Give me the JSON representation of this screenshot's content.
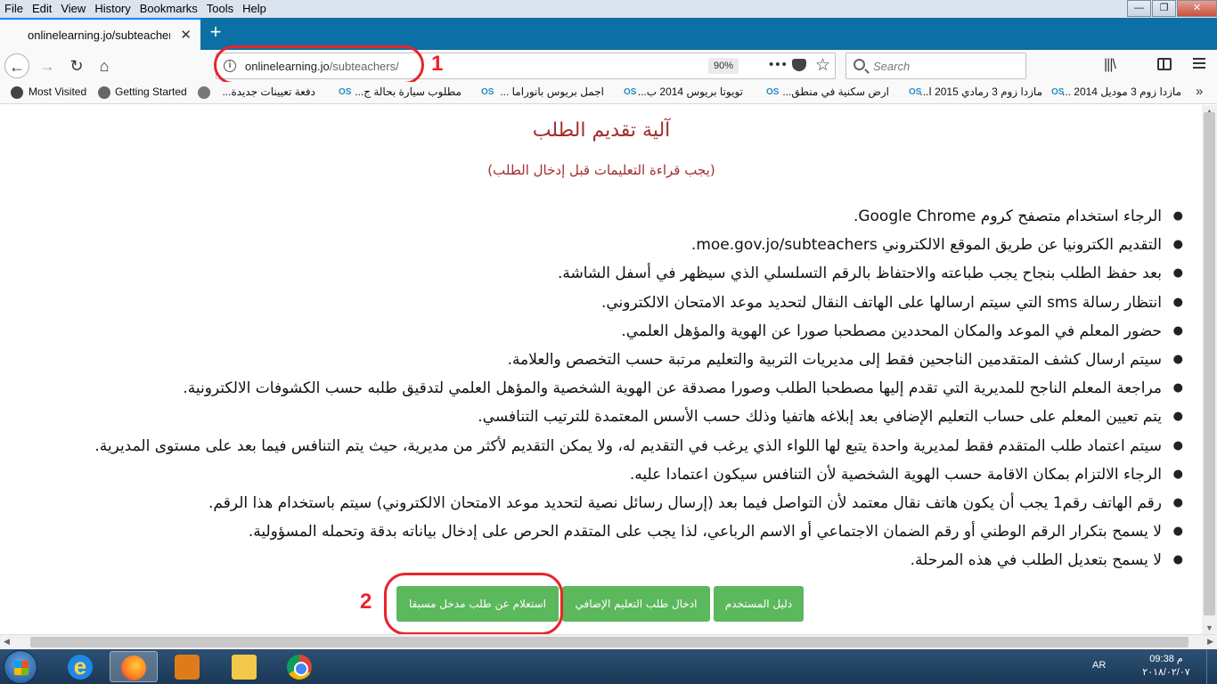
{
  "menubar": {
    "items": [
      "File",
      "Edit",
      "View",
      "History",
      "Bookmarks",
      "Tools",
      "Help"
    ]
  },
  "window_controls": {
    "minimize": "—",
    "maximize": "❐",
    "close": "✕"
  },
  "tab": {
    "title": "onlinelearning.jo/subteachers/",
    "close": "✕",
    "new_tab": "+"
  },
  "navbar": {
    "url_host": "onlinelearning.jo",
    "url_path": "/subteachers/",
    "zoom": "90%",
    "page_actions": "•••",
    "search_placeholder": "Search"
  },
  "annotations": {
    "label_1": "1",
    "label_2": "2",
    "color": "#e8242c"
  },
  "bookmarks": {
    "most_visited": "Most Visited",
    "getting_started": "Getting Started",
    "items": [
      "دفعة تعيينات جديدة...",
      "مطلوب سيارة بحالة ج...",
      "اجمل بريوس بانوراما ...",
      "تويوتا بريوس 2014 ب...",
      "ارض سكنية في منطق...",
      "مازدا زوم 3 رمادي 2015 ا...",
      "مازدا زوم 3 موديل 2014 ..."
    ],
    "badge": "OS"
  },
  "page": {
    "title": "آلية تقديم الطلب",
    "subtitle": "(يجب قراءة التعليمات قبل إدخال الطلب)",
    "title_color": "#a42d2d",
    "rules": [
      "الرجاء استخدام متصفح كروم Google Chrome.",
      "التقديم الكترونيا عن طريق الموقع الالكتروني moe.gov.jo/subteachers.",
      "بعد حفظ الطلب بنجاح يجب طباعته والاحتفاظ بالرقم التسلسلي الذي سيظهر في أسفل الشاشة.",
      "انتظار رسالة sms التي سيتم ارسالها على الهاتف النقال لتحديد موعد الامتحان الالكتروني.",
      "حضور المعلم في الموعد والمكان المحددين مصطحبا صورا عن الهوية والمؤهل العلمي.",
      "سيتم ارسال كشف المتقدمين الناجحين فقط إلى مديريات التربية والتعليم مرتبة حسب التخصص والعلامة.",
      "مراجعة المعلم الناجح للمديرية التي تقدم إليها مصطحبا الطلب وصورا مصدقة عن الهوية الشخصية والمؤهل العلمي لتدقيق طلبه حسب الكشوفات الالكترونية.",
      "يتم تعيين المعلم على حساب التعليم الإضافي بعد إبلاغه هاتفيا وذلك حسب الأسس المعتمدة للترتيب التنافسي.",
      "سيتم اعتماد طلب المتقدم فقط لمديرية واحدة يتبع لها اللواء الذي يرغب في التقديم له، ولا يمكن التقديم لأكثر من مديرية، حيث يتم التنافس فيما بعد على مستوى المديرية.",
      "الرجاء الالتزام بمكان الاقامة حسب الهوية الشخصية لأن التنافس سيكون اعتمادا عليه.",
      "رقم الهاتف رقم1 يجب أن يكون هاتف نقال معتمد لأن التواصل فيما بعد (إرسال رسائل نصية لتحديد موعد الامتحان الالكتروني) سيتم باستخدام هذا الرقم.",
      "لا يسمح بتكرار الرقم الوطني أو رقم الضمان الاجتماعي أو الاسم الرباعي، لذا يجب على المتقدم الحرص على إدخال بياناته بدقة وتحمله المسؤولية.",
      "لا يسمح بتعديل الطلب في هذه المرحلة."
    ],
    "buttons": {
      "inquiry": "استعلام عن طلب مدخل مسبقا",
      "add_extra": "ادخال طلب التعليم الإضافي",
      "user_guide": "دليل المستخدم"
    },
    "button_color": "#5cb85c"
  },
  "taskbar": {
    "lang": "AR",
    "time": "09:38 م",
    "date": "٢٠١٨/٠٢/٠٧"
  }
}
